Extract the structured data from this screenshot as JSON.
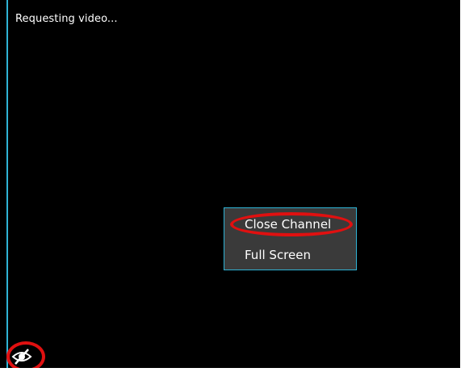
{
  "video": {
    "status_text": "Requesting video..."
  },
  "context_menu": {
    "items": [
      {
        "label": "Close Channel"
      },
      {
        "label": "Full Screen"
      }
    ]
  },
  "icons": {
    "stream_toggle": "eye-slash-icon"
  },
  "colors": {
    "panel_background": "#000000",
    "accent_border": "#2fb4d6",
    "menu_background": "#3a3a3a",
    "annotation": "#e01010"
  }
}
